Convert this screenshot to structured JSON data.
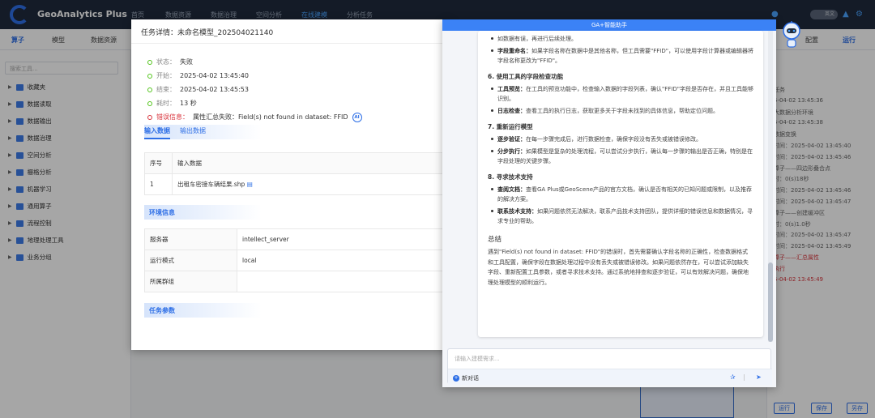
{
  "app": {
    "brand": "GeoAnalytics Plus"
  },
  "topnav": {
    "items": [
      "首页",
      "数据资源",
      "数据治理",
      "空间分析",
      "在线建模",
      "分析任务"
    ],
    "active_index": 4,
    "toggle_label": "英文"
  },
  "toolbar": {
    "left": [
      "算子",
      "模型",
      "数据资源"
    ],
    "right": [
      "配置",
      "运行"
    ]
  },
  "left": {
    "search_placeholder": "搜索工具...",
    "tree": [
      "收藏夹",
      "数据读取",
      "数据输出",
      "数据治理",
      "空间分析",
      "栅格分析",
      "机器学习",
      "通用算子",
      "流程控制",
      "地理处理工具",
      "业务分组"
    ]
  },
  "modal": {
    "title": "任务详情：未命名模型_202504021140",
    "status_label": "状态：",
    "status_value": "失败",
    "start_label": "开始：",
    "start_value": "2025-04-02 13:45:40",
    "end_label": "结束：",
    "end_value": "2025-04-02 13:45:53",
    "dur_label": "耗时：",
    "dur_value": "13 秒",
    "err_label": "错误信息：",
    "err_value": "属性汇总失败：Field(s) not found in dataset: FFID",
    "ai_badge": "AI",
    "tab_input": "输入数据",
    "tab_output": "输出数据",
    "table_head": [
      "序号",
      "输入数据"
    ],
    "table_row": [
      "1",
      "出租车密接车辆结果.shp"
    ],
    "env_title": "环境信息",
    "env_rows": [
      [
        "服务器",
        "intellect_server"
      ],
      [
        "运行模式",
        "local"
      ],
      [
        "所属群组",
        ""
      ]
    ],
    "param_title": "任务参数"
  },
  "chat": {
    "title": "GA+智能助手",
    "top_fragment": "如数据有误，再进行后续处理。",
    "b0_key": "字段重命名：",
    "b0_text": "如果字段名称在数据中是其他名称，但工具需要\"FFID\"，可以使用字段计算器或编辑器将字段名称更改为\"FFID\"。",
    "s6": "6. 使用工具的字段检查功能",
    "s6b1_key": "工具预览：",
    "s6b1_text": "在工具的预览功能中，检查输入数据的字段列表，确认\"FFID\"字段是否存在，并且工具能够识别。",
    "s6b2_key": "日志检查：",
    "s6b2_text": "查看工具的执行日志，获取更多关于字段未找到的具体信息，帮助定位问题。",
    "s7": "7. 重新运行模型",
    "s7b1_key": "逐步验证：",
    "s7b1_text": "在每一步骤完成后，进行数据检查，确保字段没有丢失或被错误修改。",
    "s7b2_key": "分步执行：",
    "s7b2_text": "如果模型是复杂的处理流程，可以尝试分步执行，确认每一步骤的输出是否正确，特别是在字段处理的关键步骤。",
    "s8": "8. 寻求技术支持",
    "s8b1_key": "查阅文档：",
    "s8b1_text": "查看GA Plus或GeoScene产品的官方文档，确认是否有相关的已知问题或限制，以及推荐的解决方案。",
    "s8b2_key": "联系技术支持：",
    "s8b2_text": "如果问题依然无法解决，联系产品技术支持团队，提供详细的错误信息和数据情况，寻求专业的帮助。",
    "summary_title": "总结",
    "summary": "遇到\"Field(s) not found in dataset: FFID\"的错误时，首先需要确认字段名称的正确性，检查数据格式和工具配置，确保字段在数据处理过程中没有丢失或被错误修改。如果问题依然存在，可以尝试添加缺失字段、重新配置工具参数，或者寻求技术支持。通过系统地排查和逐步验证，可以有效解决问题，确保地理处理模型的顺利运行。",
    "input_placeholder": "请输入建模需求...",
    "new_chat": "新对话"
  },
  "right": {
    "lines": [
      {
        "t": "任务",
        "err": false
      },
      {
        "t": "5-04-02 13:45:36",
        "err": false
      },
      {
        "t": "大数据分析环境",
        "err": false
      },
      {
        "t": "5-04-02 13:45:38",
        "err": false
      },
      {
        "t": "数据变换",
        "err": false
      },
      {
        "t": "时间：2025-04-02 13:45:40",
        "err": false
      },
      {
        "t": "时间：2025-04-02 13:45:46",
        "err": false
      },
      {
        "t": "算子——四边形叠合点",
        "err": false
      },
      {
        "t": "时：0(s)18秒",
        "err": false
      },
      {
        "t": "时间：2025-04-02 13:45:46",
        "err": false
      },
      {
        "t": "时间：2025-04-02 13:45:47",
        "err": false
      },
      {
        "t": "算子——创建缓冲区",
        "err": false
      },
      {
        "t": "时：0(s)1.0秒",
        "err": false
      },
      {
        "t": "时间：2025-04-02 13:45:47",
        "err": false
      },
      {
        "t": "时间：2025-04-02 13:45:49",
        "err": false
      },
      {
        "t": "算子——汇总属性",
        "err": true
      },
      {
        "t": "执行",
        "err": true
      },
      {
        "t": "5-04-02 13:45:49",
        "err": true
      }
    ],
    "buttons": [
      "运行",
      "保存",
      "另存"
    ]
  }
}
